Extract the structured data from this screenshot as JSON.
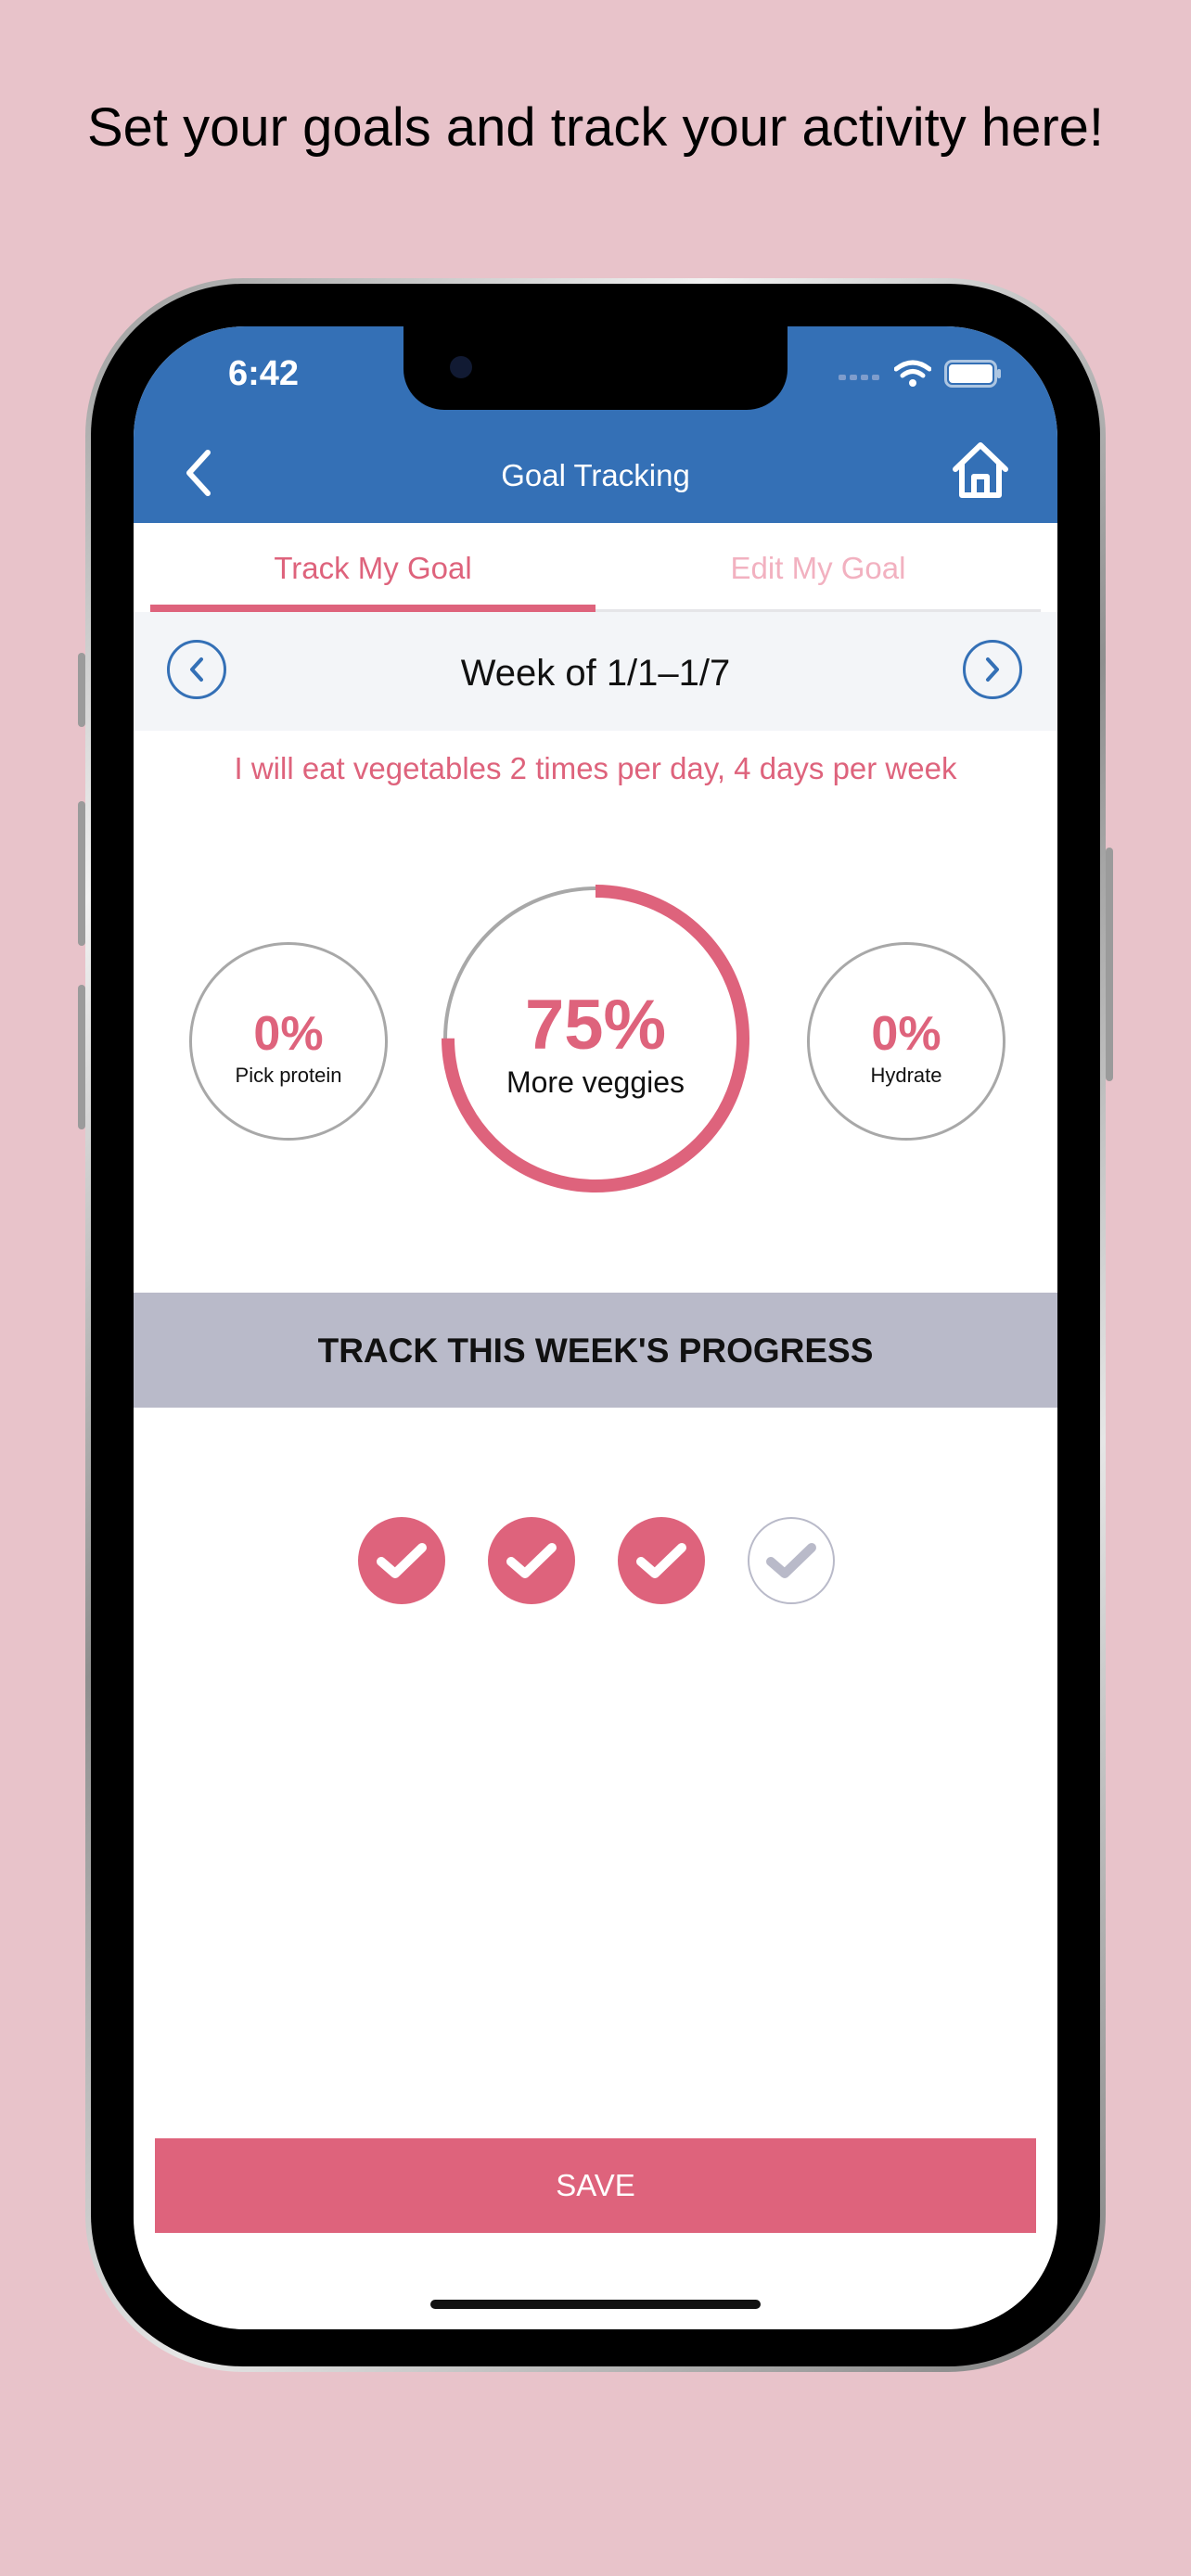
{
  "headline": "Set your goals and track your activity here!",
  "status": {
    "time": "6:42"
  },
  "header": {
    "title": "Goal Tracking",
    "back_icon": "chevron-left-icon",
    "home_icon": "home-icon"
  },
  "tabs": [
    {
      "label": "Track My Goal",
      "active": true
    },
    {
      "label": "Edit My Goal",
      "active": false
    }
  ],
  "week": {
    "label": "Week of 1/1–1/7"
  },
  "goal_statement": "I will eat vegetables 2 times per day, 4 days per week",
  "goals": {
    "left": {
      "percent": "0%",
      "label": "Pick protein"
    },
    "center": {
      "percent": "75%",
      "label": "More veggies",
      "progress": 0.75
    },
    "right": {
      "percent": "0%",
      "label": "Hydrate"
    }
  },
  "progress_section": {
    "title": "TRACK THIS WEEK'S PROGRESS"
  },
  "checks": [
    true,
    true,
    true,
    false
  ],
  "save_label": "SAVE",
  "colors": {
    "primary": "#3470b6",
    "accent": "#de637c",
    "section": "#b9bac9",
    "background": "#e8c3ca"
  }
}
